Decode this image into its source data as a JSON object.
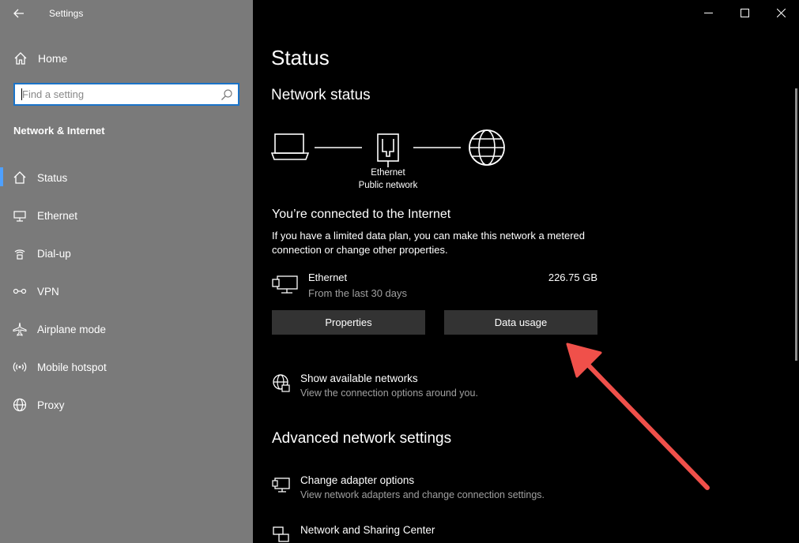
{
  "window": {
    "app_title": "Settings"
  },
  "sidebar": {
    "home_label": "Home",
    "search": {
      "placeholder": "Find a setting"
    },
    "section_title": "Network & Internet",
    "items": [
      {
        "label": "Status",
        "icon": "home-status-icon",
        "active": true
      },
      {
        "label": "Ethernet",
        "icon": "ethernet-icon",
        "active": false
      },
      {
        "label": "Dial-up",
        "icon": "dialup-icon",
        "active": false
      },
      {
        "label": "VPN",
        "icon": "vpn-icon",
        "active": false
      },
      {
        "label": "Airplane mode",
        "icon": "airplane-icon",
        "active": false
      },
      {
        "label": "Mobile hotspot",
        "icon": "hotspot-icon",
        "active": false
      },
      {
        "label": "Proxy",
        "icon": "globe-icon",
        "active": false
      }
    ]
  },
  "main": {
    "page_title": "Status",
    "network_status_title": "Network status",
    "diagram": {
      "adapter_name": "Ethernet",
      "network_type": "Public network"
    },
    "connected_title": "You’re connected to the Internet",
    "connected_desc": "If you have a limited data plan, you can make this network a metered connection or change other properties.",
    "ethernet": {
      "name": "Ethernet",
      "period": "From the last 30 days",
      "amount": "226.75 GB"
    },
    "buttons": {
      "properties": "Properties",
      "data_usage": "Data usage"
    },
    "show_networks": {
      "title": "Show available networks",
      "subtitle": "View the connection options around you."
    },
    "advanced_title": "Advanced network settings",
    "adapter_options": {
      "title": "Change adapter options",
      "subtitle": "View network adapters and change connection settings."
    },
    "sharing_center": {
      "title": "Network and Sharing Center"
    }
  },
  "colors": {
    "sidebar_bg": "#7a7a7a",
    "main_bg": "#000000",
    "accent": "#4ea0ff",
    "button_bg": "#333333",
    "annotation_arrow": "#f0504a"
  }
}
